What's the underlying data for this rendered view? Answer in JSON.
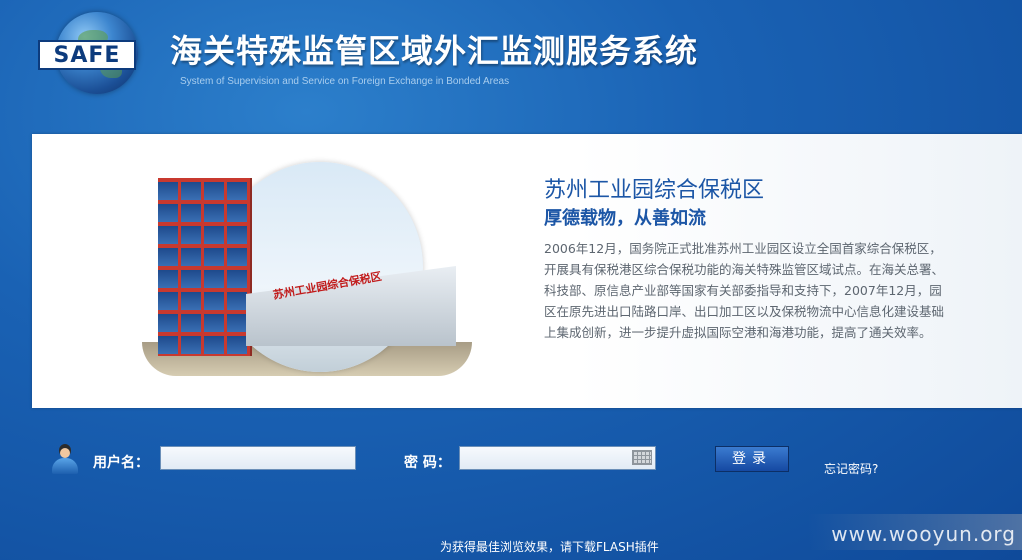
{
  "header": {
    "logo_text": "SAFE",
    "title": "海关特殊监管区域外汇监测服务系统",
    "subtitle": "System of Supervision and Service on Foreign Exchange in Bonded Areas"
  },
  "intro": {
    "zone_title": "苏州工业园综合保税区",
    "slogan": "厚德载物，从善如流",
    "description": "2006年12月，国务院正式批准苏州工业园区设立全国首家综合保税区，开展具有保税港区综合保税功能的海关特殊监管区域试点。在海关总署、科技部、原信息产业部等国家有关部委指导和支持下，2007年12月，园区在原先进出口陆路口岸、出口加工区以及保税物流中心信息化建设基础上集成创新，进一步提升虚拟国际空港和海港功能，提高了通关效率。",
    "gate_sign": "苏州工业园综合保税区"
  },
  "login": {
    "username_label": "用户名：",
    "username_value": "",
    "password_label": "密 码：",
    "password_value": "",
    "submit_label": "登录",
    "forgot_label": "忘记密码?"
  },
  "footer": {
    "note": "为获得最佳浏览效果，请下载FLASH插件",
    "watermark": "www.wooyun.org"
  },
  "colors": {
    "background": "#1a62b4",
    "title_blue": "#1c56a6",
    "button": "#1549a2"
  }
}
